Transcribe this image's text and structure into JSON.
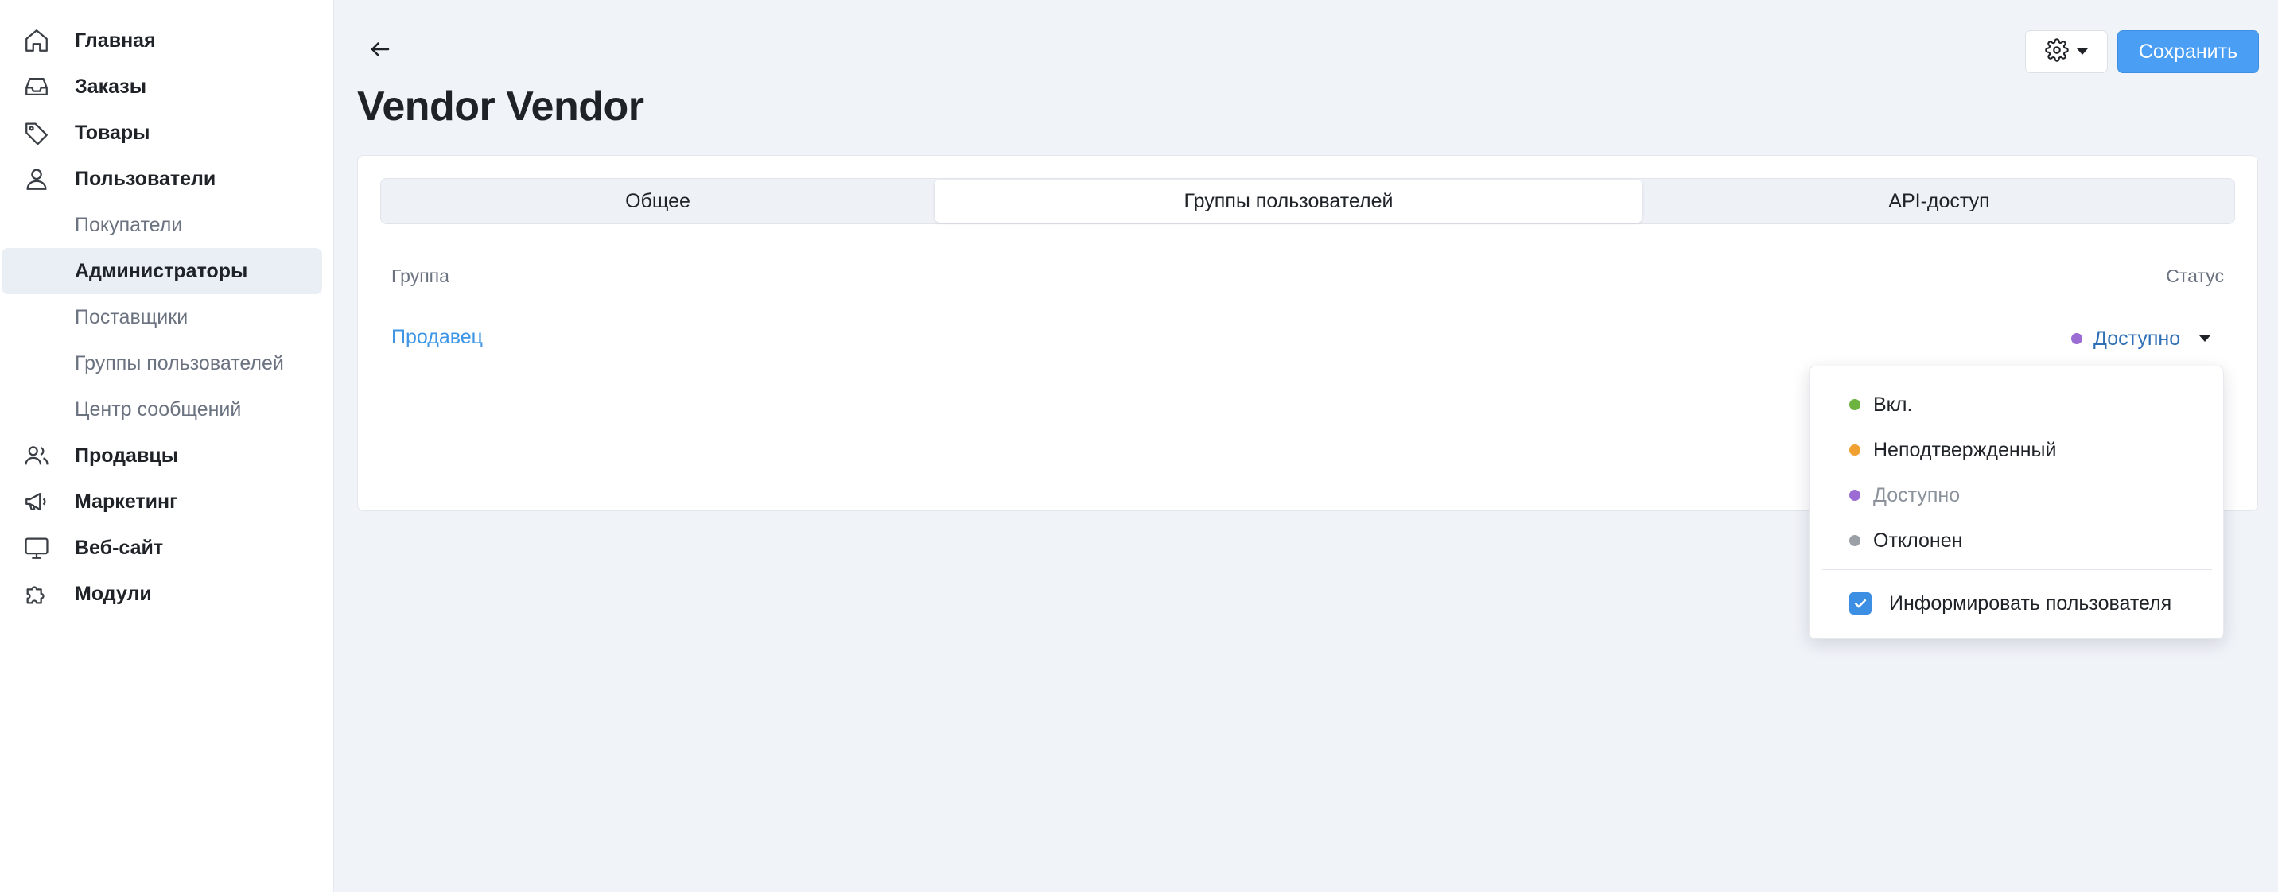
{
  "sidebar": {
    "items": [
      {
        "label": "Главная",
        "icon": "home-icon"
      },
      {
        "label": "Заказы",
        "icon": "inbox-icon"
      },
      {
        "label": "Товары",
        "icon": "tag-icon"
      },
      {
        "label": "Пользователи",
        "icon": "user-icon"
      },
      {
        "label": "Покупатели"
      },
      {
        "label": "Администраторы"
      },
      {
        "label": "Поставщики"
      },
      {
        "label": "Группы пользователей"
      },
      {
        "label": "Центр сообщений"
      },
      {
        "label": "Продавцы",
        "icon": "users-icon"
      },
      {
        "label": "Маркетинг",
        "icon": "megaphone-icon"
      },
      {
        "label": "Веб-сайт",
        "icon": "monitor-icon"
      },
      {
        "label": "Модули",
        "icon": "puzzle-icon"
      }
    ],
    "active": "Администраторы"
  },
  "header": {
    "title": "Vendor Vendor",
    "save_label": "Сохранить",
    "settings_icon": "gear-icon",
    "back_icon": "arrow-left-icon"
  },
  "tabs": [
    {
      "label": "Общее"
    },
    {
      "label": "Группы пользователей",
      "active": true
    },
    {
      "label": "API-доступ"
    }
  ],
  "table": {
    "columns": [
      "Группа",
      "Статус"
    ],
    "rows": [
      {
        "group": "Продавец",
        "status": "Доступно"
      }
    ]
  },
  "status_dropdown": {
    "options": [
      {
        "label": "Вкл.",
        "color": "#6cb33f"
      },
      {
        "label": "Неподтвержденный",
        "color": "#f0a030"
      },
      {
        "label": "Доступно",
        "color": "#9b6dd4",
        "current": true
      },
      {
        "label": "Отклонен",
        "color": "#9aa0a6"
      }
    ],
    "notify_label": "Информировать пользователя",
    "notify_checked": true
  },
  "colors": {
    "accent": "#4a9ff5",
    "link": "#3d95e6",
    "background": "#f0f3f8"
  }
}
